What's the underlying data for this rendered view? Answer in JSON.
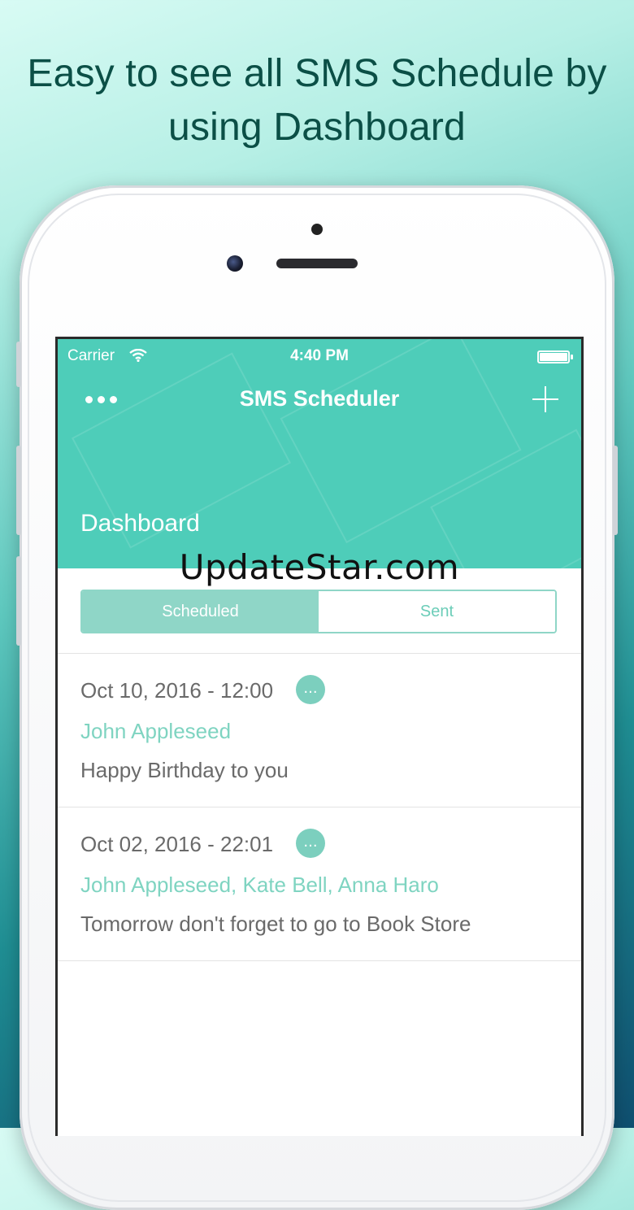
{
  "headline": {
    "line1": "Easy to see all SMS Schedule by",
    "line2": "using Dashboard"
  },
  "status_bar": {
    "carrier": "Carrier",
    "time": "4:40 PM"
  },
  "navbar": {
    "title": "SMS Scheduler"
  },
  "dashboard": {
    "title": "Dashboard"
  },
  "watermark": "UpdateStar.com",
  "tabs": {
    "scheduled": "Scheduled",
    "sent": "Sent"
  },
  "messages": [
    {
      "datetime": "Oct 10, 2016 - 12:00",
      "more": "...",
      "recipients": "John Appleseed",
      "text": "Happy Birthday to you"
    },
    {
      "datetime": "Oct 02, 2016 - 22:01",
      "more": "...",
      "recipients": "John Appleseed, Kate Bell, Anna Haro",
      "text": "Tomorrow don't forget to go to Book Store"
    }
  ],
  "colors": {
    "accent": "#4ecdb9",
    "segment_active": "#8fd6c7",
    "recipient_text": "#7fd4c1",
    "headline_text": "#0b4f46"
  }
}
